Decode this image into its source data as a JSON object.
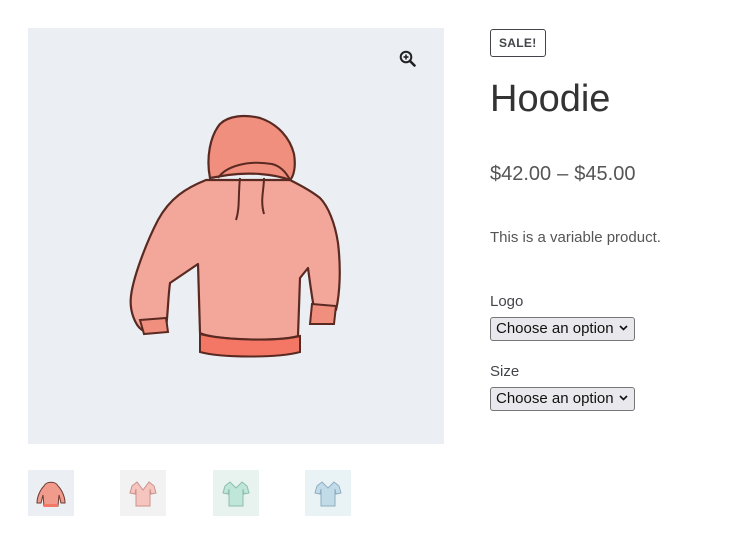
{
  "product": {
    "badge": "SALE!",
    "title": "Hoodie",
    "price_min": "$42.00",
    "price_separator": "–",
    "price_max": "$45.00",
    "description": "This is a variable product."
  },
  "variations": {
    "logo": {
      "label": "Logo",
      "selected": "Choose an option"
    },
    "size": {
      "label": "Size",
      "selected": "Choose an option"
    }
  },
  "gallery": {
    "zoom_icon": "magnify-plus-icon",
    "main_image": "hoodie-image",
    "thumbnails": [
      {
        "name": "hoodie-thumbnail",
        "color": "#f19b8c"
      },
      {
        "name": "pink-tshirt-thumbnail",
        "color": "#f7c5bf"
      },
      {
        "name": "mint-tshirt-thumbnail",
        "color": "#bfe6d9"
      },
      {
        "name": "blue-tshirt-thumbnail",
        "color": "#c2dbe8"
      }
    ]
  }
}
